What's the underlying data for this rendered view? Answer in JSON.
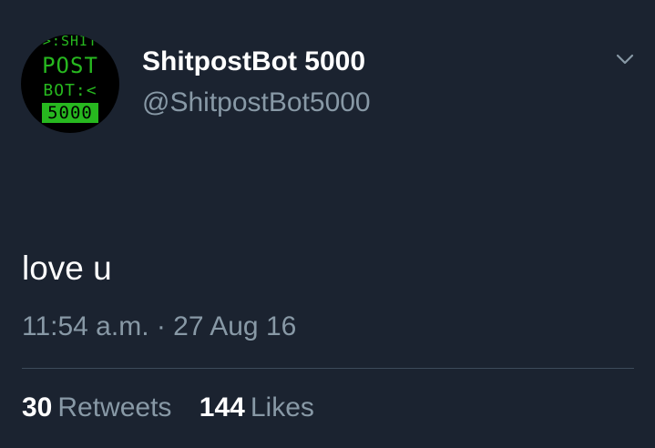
{
  "tweet": {
    "avatar": {
      "icon": "shitpostbot-avatar-icon",
      "lines": [
        ">:SHIT",
        "POST",
        "BOT:<",
        "5000"
      ],
      "colors": {
        "text": "#27b81f",
        "background": "#000000"
      }
    },
    "display_name": "ShitpostBot 5000",
    "handle": "@ShitpostBot5000",
    "menu_icon": "chevron-down-icon",
    "text": "love u",
    "timestamp": "11:54 a.m. · 27 Aug 16",
    "stats": {
      "retweets": {
        "count": "30",
        "label": "Retweets"
      },
      "likes": {
        "count": "144",
        "label": "Likes"
      }
    }
  },
  "colors": {
    "background": "#1b2330",
    "secondary_text": "#8899a6",
    "primary_text": "#ffffff",
    "divider": "#3d4b5a"
  }
}
